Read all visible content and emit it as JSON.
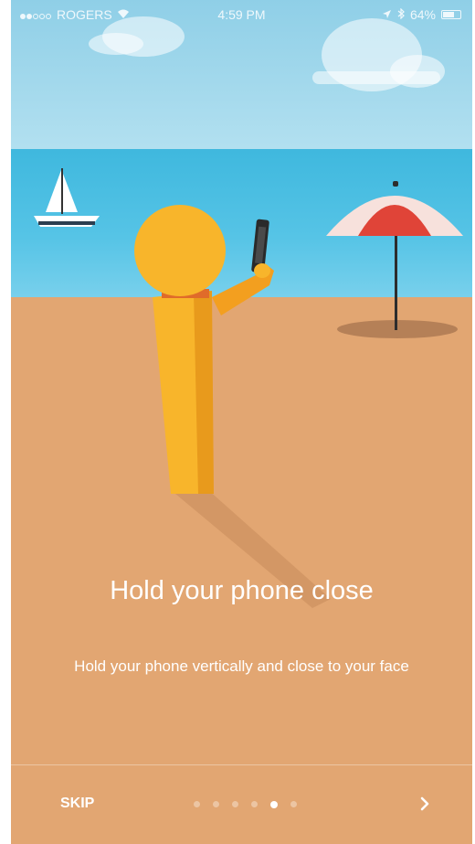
{
  "status_bar": {
    "carrier": "ROGERS",
    "time": "4:59 PM",
    "battery_text": "64%",
    "battery_level": 0.64
  },
  "onboarding": {
    "title": "Hold your phone close",
    "subtitle": "Hold your phone vertically and close to your face",
    "skip_label": "SKIP",
    "page_count": 6,
    "active_page": 5,
    "next_icon": "chevron-right-icon"
  },
  "colors": {
    "sky": "#9fd6ec",
    "sea": "#4cbfe3",
    "sand": "#e2a672",
    "figure": "#f8b52b",
    "umbrella_red": "#e04438"
  }
}
